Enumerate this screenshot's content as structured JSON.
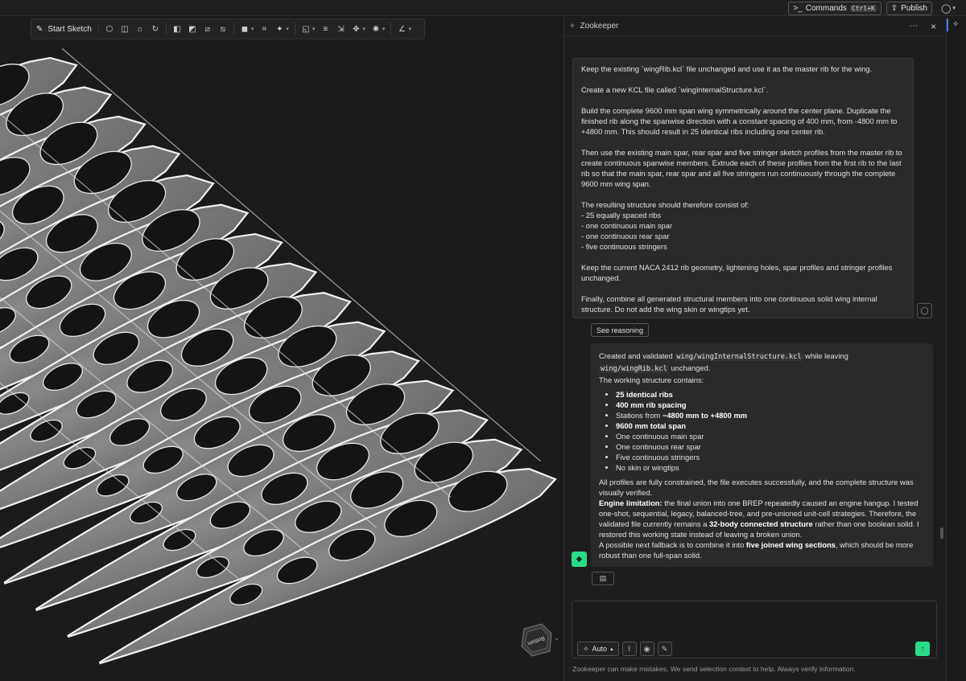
{
  "topbar": {
    "commands_label": "Commands",
    "commands_shortcut": "Ctrl+K",
    "publish_label": "Publish"
  },
  "toolbar": {
    "start_sketch_label": "Start Sketch"
  },
  "viewport": {
    "nav_cube_face": "Bottom"
  },
  "panel": {
    "title": "Zookeeper",
    "more_label": "⋯",
    "close_label": "×"
  },
  "user_message": {
    "paragraphs": [
      "Keep the existing `wingRib.kcl` file unchanged and use it as the master rib for the wing.",
      "Create a new KCL file called `wingInternalStructure.kcl`.",
      "Build the complete 9600 mm span wing symmetrically around the center plane. Duplicate the finished rib along the spanwise direction with a constant spacing of 400 mm, from -4800 mm to +4800 mm. This should result in 25 identical ribs including one center rib.",
      "Then use the existing main spar, rear spar and five stringer sketch profiles from the master rib to create continuous spanwise members. Extrude each of these profiles from the first rib to the last rib so that the main spar, rear spar and all five stringers run continuously through the complete 9600 mm wing span.",
      "The resulting structure should therefore consist of:\n- 25 equally spaced ribs\n- one continuous main spar\n- one continuous rear spar\n- five continuous stringers",
      "Keep the current NACA 2412 rib geometry, lightening holes, spar profiles and stringer profiles unchanged.",
      "Finally, combine all generated structural members into one continuous solid wing internal structure. Do not add the wing skin or wingtips yet."
    ]
  },
  "see_reasoning_label": "See reasoning",
  "assistant_message": {
    "intro_1": "Created and validated ",
    "code_1": "wing/wingInternalStructure.kcl",
    "intro_2": " while leaving ",
    "code_2": "wing/wingRib.kcl",
    "intro_3": " unchanged.",
    "intro_4": "The working structure contains:",
    "items": [
      {
        "bold": "25 identical ribs",
        "text": ""
      },
      {
        "bold": "400 mm rib spacing",
        "text": ""
      },
      {
        "bold": "",
        "text": "Stations from ",
        "bold2": "−4800 mm to +4800 mm"
      },
      {
        "bold": "9600 mm total span",
        "text": ""
      },
      {
        "bold": "",
        "text": "One continuous main spar"
      },
      {
        "bold": "",
        "text": "One continuous rear spar"
      },
      {
        "bold": "",
        "text": "Five continuous stringers"
      },
      {
        "bold": "",
        "text": "No skin or wingtips"
      }
    ],
    "para_1": "All profiles are fully constrained, the file executes successfully, and the complete structure was visually verified.",
    "engine_bold": "Engine limitation:",
    "engine_text_1": " the final union into one BREP repeatedly caused an engine hangup. I tested one-shot, sequential, legacy, balanced-tree, and pre-unioned unit-cell strategies. Therefore, the validated file currently remains a ",
    "engine_bold_2": "32-body connected structure",
    "engine_text_2": " rather than one boolean solid. I restored this working state instead of leaving a broken union.",
    "fallback_text_1": "A possible next fallback is to combine it into ",
    "fallback_bold": "five joined wing sections",
    "fallback_text_2": ", which should be more robust than one full-span solid."
  },
  "composer": {
    "mode_label": "Auto",
    "placeholder": "",
    "disclaimer": "Zookeeper can make mistakes. We send selection context to help. Always verify information."
  },
  "colors": {
    "accent_green": "#2bdc8a",
    "accent_blue": "#3b82f6",
    "background": "#1b1b1b"
  }
}
